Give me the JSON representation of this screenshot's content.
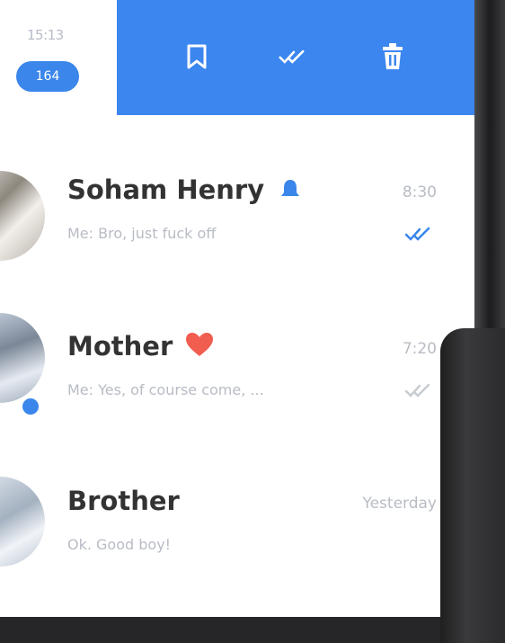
{
  "status": {
    "time": "15:13",
    "badge": "164"
  },
  "action_bar": {
    "color": "#3b86ef",
    "actions": [
      {
        "icon": "bookmark-icon"
      },
      {
        "icon": "double-check-icon"
      },
      {
        "icon": "trash-icon"
      }
    ]
  },
  "chats": [
    {
      "name": "Soham Henry",
      "emoji": "bell-icon",
      "preview": "Me: Bro, just fuck off",
      "time": "8:30",
      "read": true
    },
    {
      "name": "Mother",
      "emoji": "heart-icon",
      "preview": "Me: Yes, of course come, ...",
      "time": "7:20",
      "read": true,
      "online": true
    },
    {
      "name": "Brother",
      "preview": "Ok. Good boy!",
      "time": "Yesterday",
      "read": false
    }
  ],
  "colors": {
    "accent": "#3a86ea",
    "heart": "#f15d4f"
  }
}
